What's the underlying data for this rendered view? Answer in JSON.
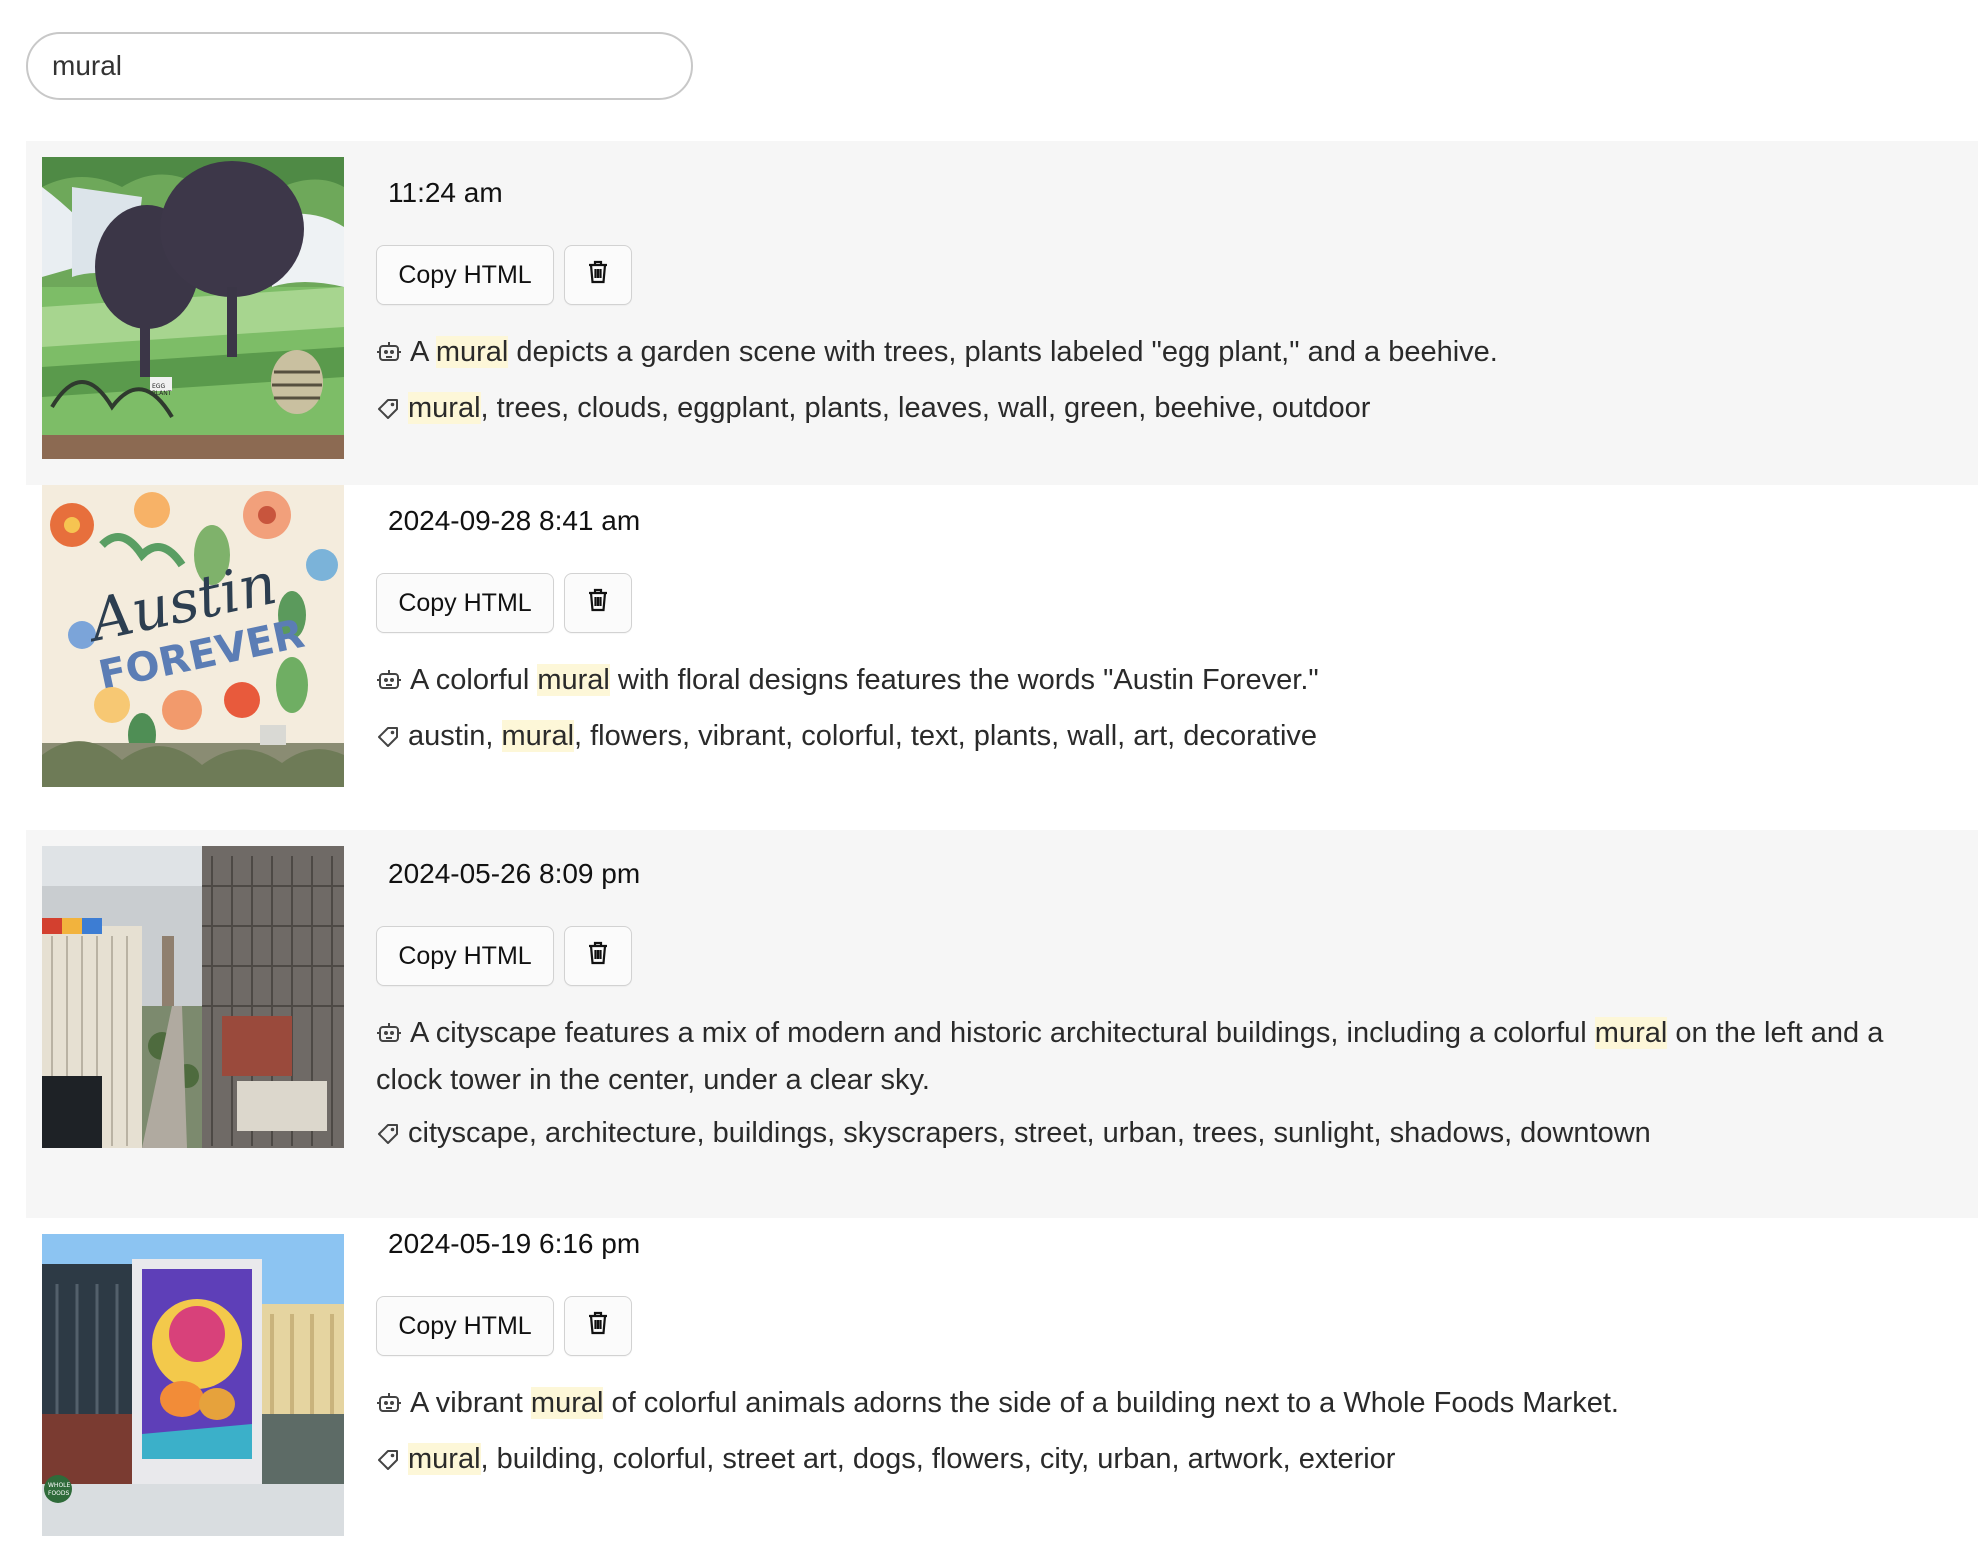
{
  "search": {
    "value": "mural"
  },
  "items": [
    {
      "time": "11:24 am",
      "copy_label": "Copy HTML",
      "description": [
        {
          "t": "A "
        },
        {
          "t": "mural",
          "hl": true
        },
        {
          "t": " depicts a garden scene with trees, plants labeled \"egg plant,\" and a beehive."
        }
      ],
      "tags": [
        {
          "t": "mural",
          "hl": true
        },
        {
          "t": ", trees, clouds, eggplant, plants, leaves, wall, green, beehive, outdoor"
        }
      ],
      "image_text": [
        "EGG",
        "PLANT"
      ]
    },
    {
      "time": "2024-09-28 8:41 am",
      "copy_label": "Copy HTML",
      "description": [
        {
          "t": "A colorful "
        },
        {
          "t": "mural",
          "hl": true
        },
        {
          "t": " with floral designs features the words \"Austin Forever.\""
        }
      ],
      "tags": [
        {
          "t": "austin, "
        },
        {
          "t": "mural",
          "hl": true
        },
        {
          "t": ", flowers, vibrant, colorful, text, plants, wall, art, decorative"
        }
      ],
      "image_text": [
        "Austin",
        "FOREVER"
      ]
    },
    {
      "time": "2024-05-26 8:09 pm",
      "copy_label": "Copy HTML",
      "description": [
        {
          "t": "A cityscape features a mix of modern and historic architectural buildings, including a colorful "
        },
        {
          "t": "mural",
          "hl": true
        },
        {
          "t": " on the left and a clock tower in the center, under a clear sky."
        }
      ],
      "tags": [
        {
          "t": "cityscape, architecture, buildings, skyscrapers, street, urban, trees, sunlight, shadows, downtown"
        }
      ]
    },
    {
      "time": "2024-05-19 6:16 pm",
      "copy_label": "Copy HTML",
      "description": [
        {
          "t": "A vibrant "
        },
        {
          "t": "mural",
          "hl": true
        },
        {
          "t": " of colorful animals adorns the side of a building next to a Whole Foods Market."
        }
      ],
      "tags": [
        {
          "t": "mural",
          "hl": true
        },
        {
          "t": ", building, colorful, street art, dogs, flowers, city, urban, artwork, exterior"
        }
      ],
      "image_text": [
        "WHOLE",
        "FOODS"
      ]
    }
  ],
  "icons": {
    "ai_description": "robot-icon",
    "tags": "tag-icon",
    "delete": "trash-icon"
  },
  "colors": {
    "highlight": "#fdf7d8",
    "row_shade": "#f6f6f6"
  }
}
